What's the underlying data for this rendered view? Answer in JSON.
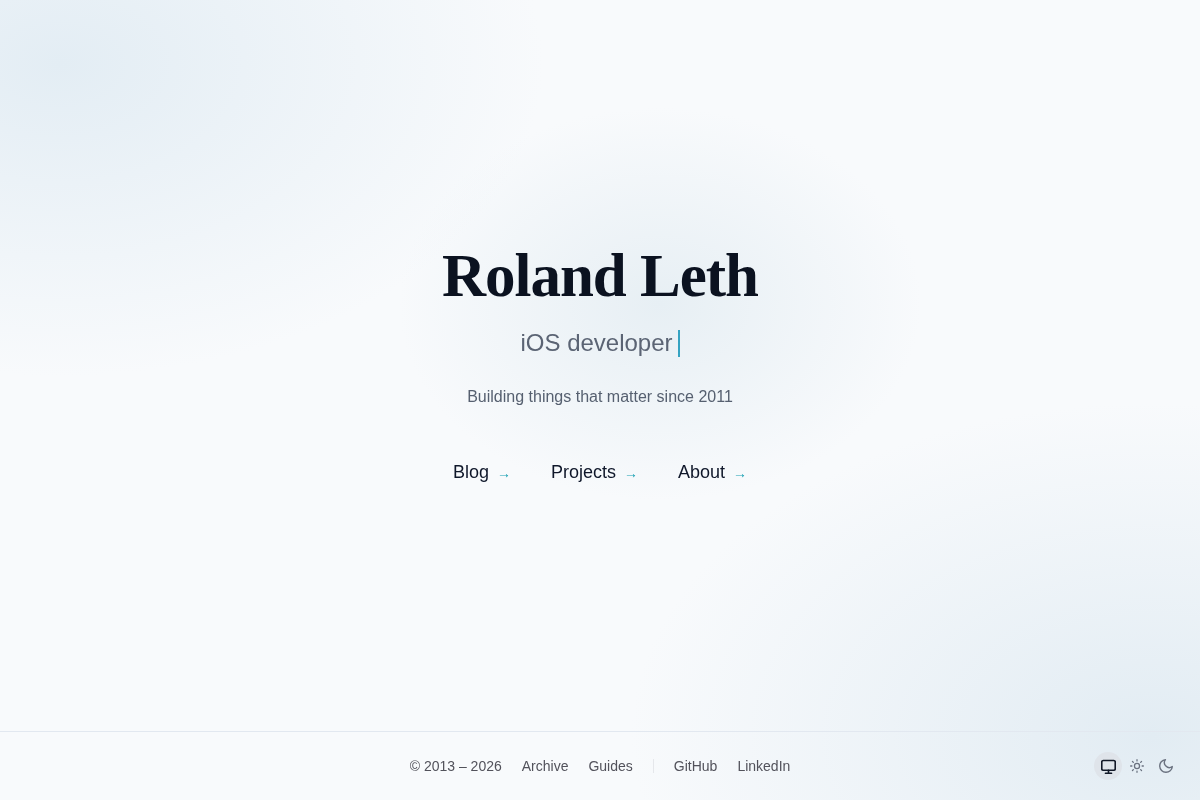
{
  "header": {
    "title": "Roland Leth",
    "subtitle": "iOS developer",
    "tagline": "Building things that matter since 2011"
  },
  "nav": [
    {
      "label": "Blog",
      "arrow": "→"
    },
    {
      "label": "Projects",
      "arrow": "→"
    },
    {
      "label": "About",
      "arrow": "→"
    }
  ],
  "footer": {
    "copyright": "© 2013 – 2026",
    "links": [
      "Archive",
      "Guides"
    ],
    "social": [
      "GitHub",
      "LinkedIn"
    ],
    "theme_options": [
      {
        "kind": "system",
        "selected": true
      },
      {
        "kind": "light",
        "selected": false
      },
      {
        "kind": "dark",
        "selected": false
      }
    ]
  }
}
